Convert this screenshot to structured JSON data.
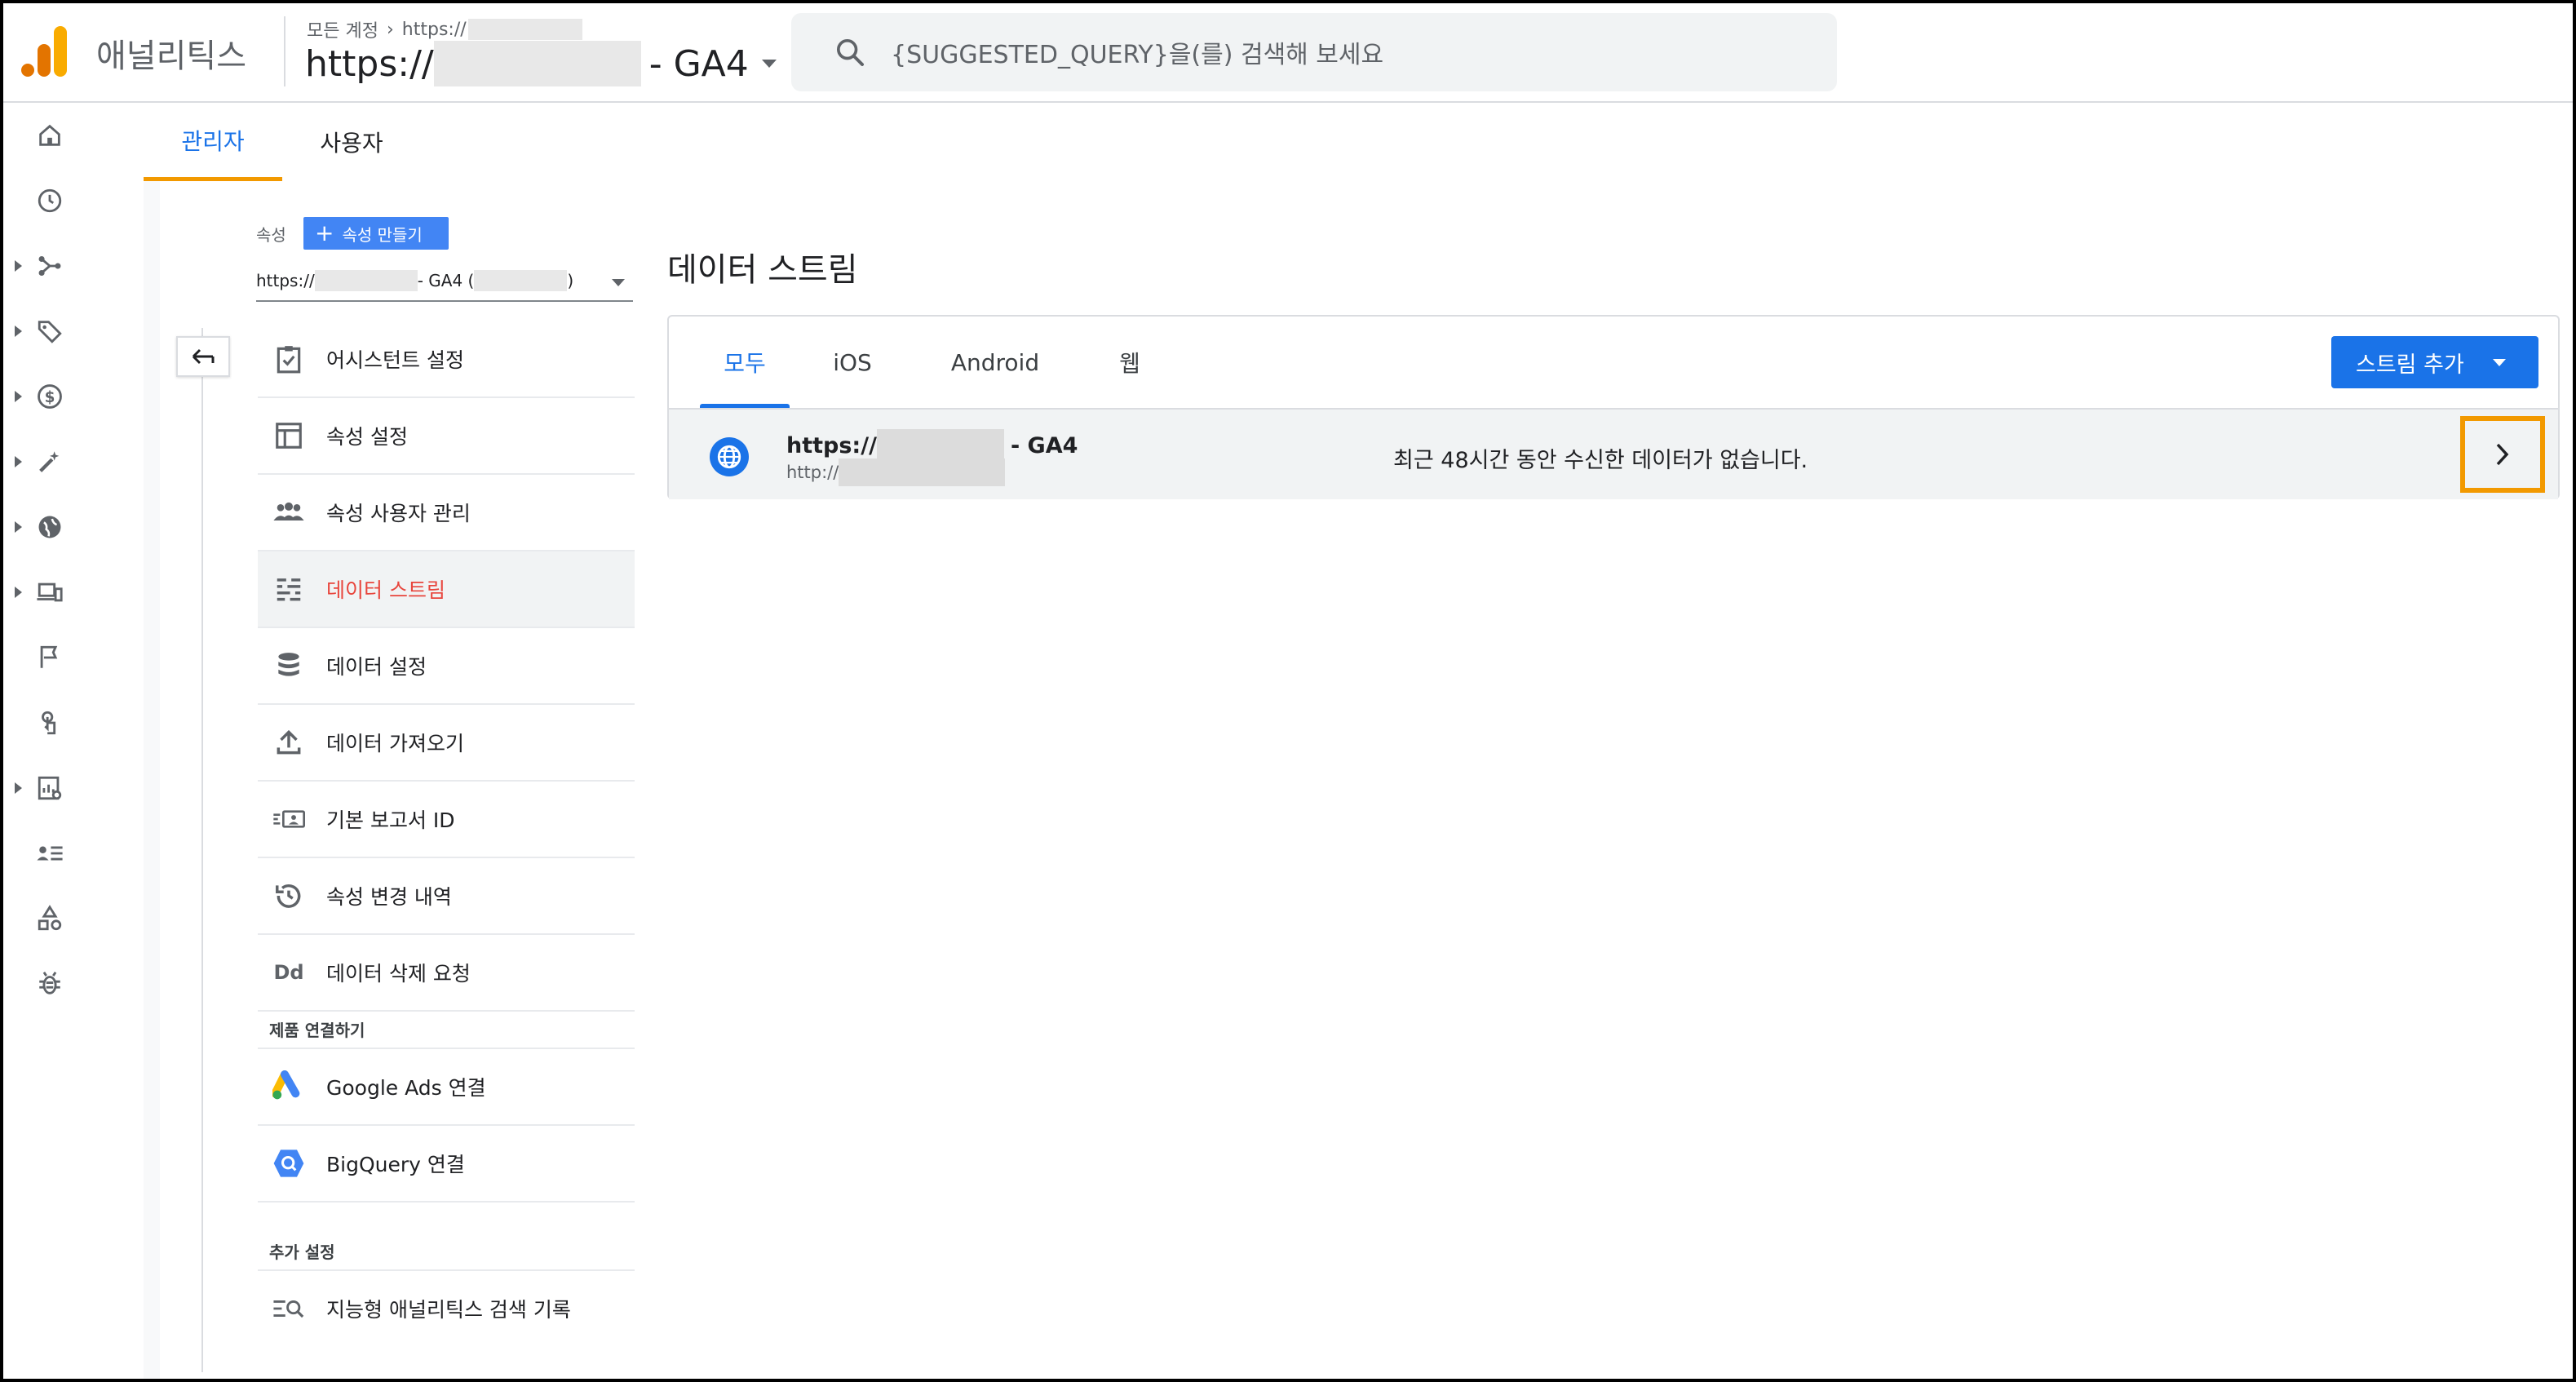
{
  "header": {
    "brand": "애널리틱스",
    "breadcrumb_account": "모든 계정",
    "breadcrumb_property": "https://",
    "property_prefix": "https://",
    "property_suffix": "- GA4",
    "search_placeholder": "{SUGGESTED_QUERY}을(를) 검색해 보세요"
  },
  "rail": {
    "items": [
      "home-icon",
      "clock-icon",
      "share-icon",
      "tag-icon",
      "dollar-icon",
      "magic-wand-icon",
      "globe-icon",
      "devices-icon",
      "flag-icon",
      "touch-icon",
      "report-icon",
      "audience-icon",
      "shapes-icon",
      "debug-icon"
    ]
  },
  "tabs": {
    "admin": "관리자",
    "user": "사용자"
  },
  "property": {
    "label": "속성",
    "create_button": "속성 만들기",
    "select_prefix": "https://",
    "select_middle": "- GA4 (",
    "select_suffix": ")"
  },
  "menu": {
    "items": [
      {
        "label": "어시스턴트 설정"
      },
      {
        "label": "속성 설정"
      },
      {
        "label": "속성 사용자 관리"
      },
      {
        "label": "데이터 스트림"
      },
      {
        "label": "데이터 설정"
      },
      {
        "label": "데이터 가져오기"
      },
      {
        "label": "기본 보고서 ID"
      },
      {
        "label": "속성 변경 내역"
      },
      {
        "label": "데이터 삭제 요청"
      }
    ],
    "section_product": "제품 연결하기",
    "product_items": [
      {
        "label": "Google Ads 연결"
      },
      {
        "label": "BigQuery 연결"
      }
    ],
    "section_extra": "추가 설정",
    "extra_items": [
      {
        "label": "지능형 애널리틱스 검색 기록"
      }
    ],
    "dd_icon_text": "Dd"
  },
  "streams": {
    "title": "데이터 스트림",
    "tabs": [
      "모두",
      "iOS",
      "Android",
      "웹"
    ],
    "add_button": "스트림 추가",
    "row": {
      "name_prefix": "https://",
      "name_suffix": "- GA4",
      "url_prefix": "http://",
      "status": "최근 48시간 동안 수신한 데이터가 없습니다."
    }
  },
  "colors": {
    "accent_blue": "#1a73e8",
    "highlight_orange": "#f29900",
    "active_red": "#e8453c"
  }
}
